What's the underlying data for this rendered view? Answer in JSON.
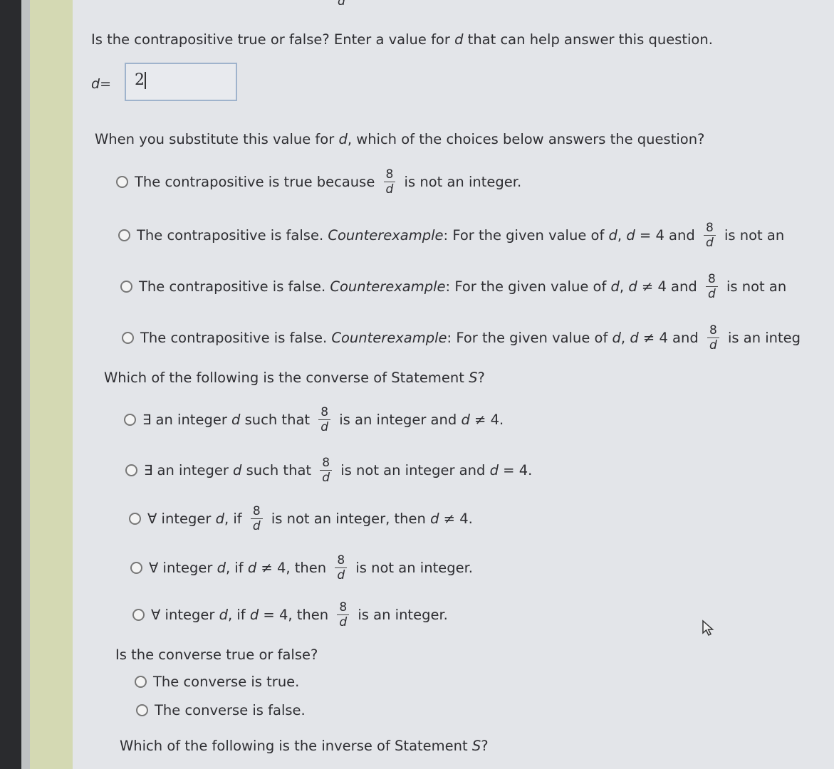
{
  "top_fragment": "d",
  "q_contrapositive": [
    {
      "t": "Is the contrapositive true or false? Enter a value for "
    },
    {
      "i": "d"
    },
    {
      "t": " that can help answer this question."
    }
  ],
  "input": {
    "label_var": "d",
    "label_eq": " =",
    "value": "2"
  },
  "q_substitute": [
    {
      "t": "When you substitute this value for "
    },
    {
      "i": "d"
    },
    {
      "t": ", which of the choices below answers the question?"
    }
  ],
  "substitute_options": [
    [
      {
        "t": "The contrapositive is true because "
      },
      {
        "frac": [
          "8",
          "d"
        ]
      },
      {
        "t": " is not an integer."
      }
    ],
    [
      {
        "t": "The contrapositive is false. "
      },
      {
        "i": "Counterexample"
      },
      {
        "t": ": For the given value of "
      },
      {
        "i": "d"
      },
      {
        "t": ", "
      },
      {
        "i": "d"
      },
      {
        "t": " = 4 and "
      },
      {
        "frac": [
          "8",
          "d"
        ]
      },
      {
        "t": " is not an"
      }
    ],
    [
      {
        "t": "The contrapositive is false. "
      },
      {
        "i": "Counterexample"
      },
      {
        "t": ": For the given value of "
      },
      {
        "i": "d"
      },
      {
        "t": ", "
      },
      {
        "i": "d"
      },
      {
        "t": " ≠ 4 and "
      },
      {
        "frac": [
          "8",
          "d"
        ]
      },
      {
        "t": " is not an"
      }
    ],
    [
      {
        "t": "The contrapositive is false. "
      },
      {
        "i": "Counterexample"
      },
      {
        "t": ": For the given value of "
      },
      {
        "i": "d"
      },
      {
        "t": ", "
      },
      {
        "i": "d"
      },
      {
        "t": " ≠ 4 and "
      },
      {
        "frac": [
          "8",
          "d"
        ]
      },
      {
        "t": " is an integ"
      }
    ]
  ],
  "q_converse": [
    {
      "t": "Which of the following is the converse of Statement "
    },
    {
      "i": "S"
    },
    {
      "t": "?"
    }
  ],
  "converse_options": [
    [
      {
        "t": "∃ an integer "
      },
      {
        "i": "d"
      },
      {
        "t": " such that "
      },
      {
        "frac": [
          "8",
          "d"
        ]
      },
      {
        "t": " is an integer and "
      },
      {
        "i": "d"
      },
      {
        "t": " ≠ 4."
      }
    ],
    [
      {
        "t": "∃ an integer "
      },
      {
        "i": "d"
      },
      {
        "t": " such that "
      },
      {
        "frac": [
          "8",
          "d"
        ]
      },
      {
        "t": " is not an integer and "
      },
      {
        "i": "d"
      },
      {
        "t": " = 4."
      }
    ],
    [
      {
        "t": "∀ integer "
      },
      {
        "i": "d"
      },
      {
        "t": ", if "
      },
      {
        "frac": [
          "8",
          "d"
        ]
      },
      {
        "t": " is not an integer, then "
      },
      {
        "i": "d"
      },
      {
        "t": " ≠ 4."
      }
    ],
    [
      {
        "t": "∀ integer "
      },
      {
        "i": "d"
      },
      {
        "t": ", if "
      },
      {
        "i": "d"
      },
      {
        "t": " ≠ 4, then "
      },
      {
        "frac": [
          "8",
          "d"
        ]
      },
      {
        "t": " is not an integer."
      }
    ],
    [
      {
        "t": "∀ integer "
      },
      {
        "i": "d"
      },
      {
        "t": ", if "
      },
      {
        "i": "d"
      },
      {
        "t": " = 4, then "
      },
      {
        "frac": [
          "8",
          "d"
        ]
      },
      {
        "t": " is an integer."
      }
    ]
  ],
  "q_converse_truth": [
    {
      "t": "Is the converse true or false?"
    }
  ],
  "converse_truth_options": [
    [
      {
        "t": "The converse is true."
      }
    ],
    [
      {
        "t": "The converse is false."
      }
    ]
  ],
  "q_inverse": [
    {
      "t": "Which of the following is the inverse of Statement "
    },
    {
      "i": "S"
    },
    {
      "t": "?"
    }
  ]
}
